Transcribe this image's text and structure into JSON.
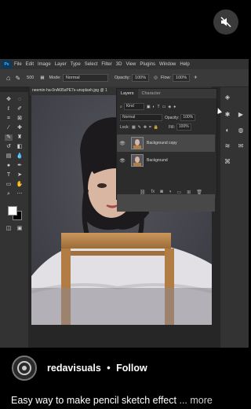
{
  "mute_button": {
    "icon": "speaker-muted-icon"
  },
  "photoshop": {
    "logo": "Ps",
    "menu": [
      "File",
      "Edit",
      "Image",
      "Layer",
      "Type",
      "Select",
      "Filter",
      "3D",
      "View",
      "Plugins",
      "Window",
      "Help"
    ],
    "options": {
      "size": "500",
      "mode_label": "Mode:",
      "mode_value": "Normal",
      "opacity_label": "Opacity:",
      "opacity_value": "100%",
      "flow_label": "Flow:",
      "flow_value": "100%"
    },
    "document_tab": "neemin-ha-0nA6l5sPE7s-unsplash.jpg @ 1",
    "layers_panel": {
      "tabs": [
        "Layers",
        "Character"
      ],
      "kind_filter": "Kind",
      "blend_mode": "Normal",
      "opacity_label": "Opacity:",
      "opacity_value": "100%",
      "lock_label": "Lock:",
      "fill_label": "Fill:",
      "fill_value": "100%",
      "layers": [
        {
          "name": "Background copy",
          "selected": true
        },
        {
          "name": "Background",
          "selected": false
        }
      ]
    }
  },
  "post": {
    "username": "redavisuals",
    "separator": "•",
    "follow_label": "Follow",
    "caption": "Easy way to make pencil sketch effect",
    "more_label": "... more"
  }
}
